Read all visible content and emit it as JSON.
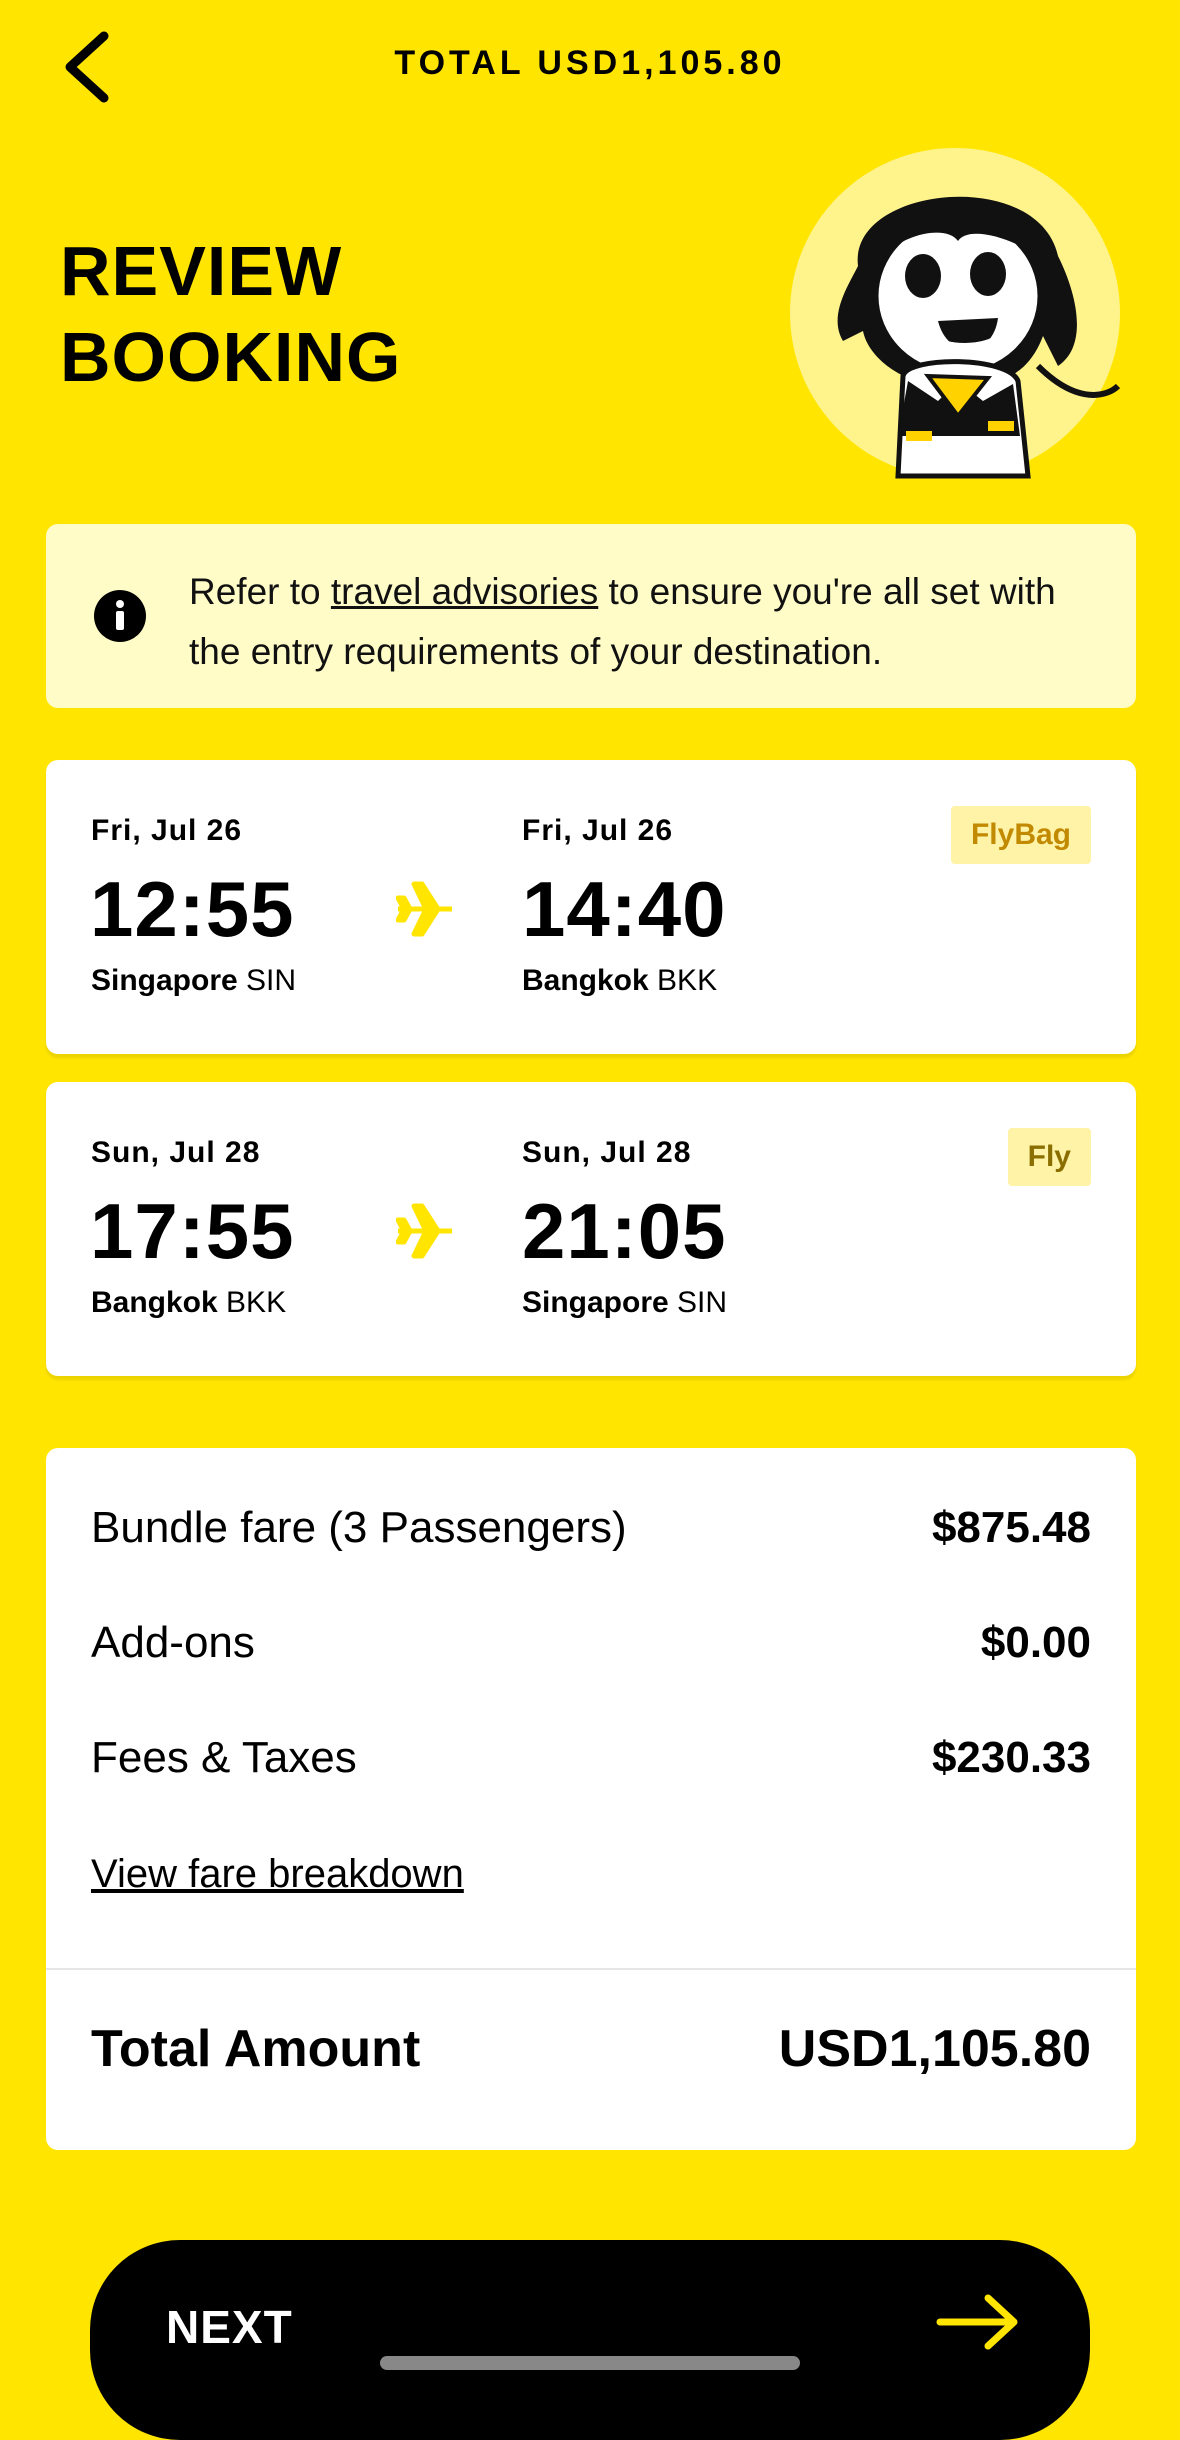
{
  "header": {
    "total_label": "TOTAL USD1,105.80",
    "back_icon": "chevron-left-icon"
  },
  "page": {
    "title_line1": "REVIEW",
    "title_line2": "BOOKING"
  },
  "advisory": {
    "icon": "info-icon",
    "text_before": "Refer to ",
    "link_text": "travel advisories",
    "text_after": " to ensure you're all set with the entry requirements of your destination."
  },
  "flights": [
    {
      "depart_date": "Fri, Jul 26",
      "depart_time": "12:55",
      "depart_city": "Singapore",
      "depart_code": "SIN",
      "arrive_date": "Fri, Jul 26",
      "arrive_time": "14:40",
      "arrive_city": "Bangkok",
      "arrive_code": "BKK",
      "bundle": "FlyBag"
    },
    {
      "depart_date": "Sun, Jul 28",
      "depart_time": "17:55",
      "depart_city": "Bangkok",
      "depart_code": "BKK",
      "arrive_date": "Sun, Jul 28",
      "arrive_time": "21:05",
      "arrive_city": "Singapore",
      "arrive_code": "SIN",
      "bundle": "Fly"
    }
  ],
  "fare": {
    "rows": [
      {
        "label": "Bundle fare (3 Passengers)",
        "value": "$875.48"
      },
      {
        "label": "Add-ons",
        "value": "$0.00"
      },
      {
        "label": "Fees & Taxes",
        "value": "$230.33"
      }
    ],
    "breakdown_link": "View fare breakdown",
    "total_label": "Total Amount",
    "total_value": "USD1,105.80"
  },
  "footer": {
    "next_label": "NEXT",
    "next_icon": "arrow-right-icon"
  },
  "colors": {
    "background": "#FFE500",
    "advisory_bg": "#FFFCC8",
    "badge_bg": "#FFF3A8",
    "accent": "#FFE500"
  }
}
